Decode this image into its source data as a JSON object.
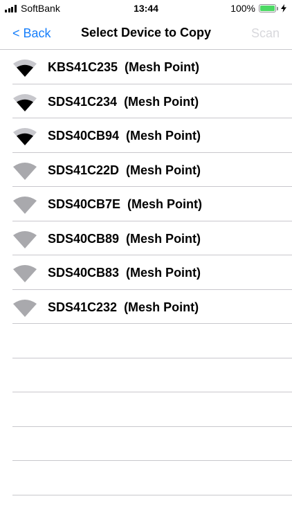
{
  "status_bar": {
    "carrier": "SoftBank",
    "time": "13:44",
    "battery_percent": "100%",
    "battery_color": "#4cd964"
  },
  "nav": {
    "back_label": "< Back",
    "title": "Select Device to Copy",
    "scan_label": "Scan",
    "accent_color": "#157efb"
  },
  "devices": [
    {
      "label": "KBS41C235  (Mesh Point)",
      "signal": "strong",
      "icon": "wifi-strong-icon"
    },
    {
      "label": "SDS41C234  (Mesh Point)",
      "signal": "strong",
      "icon": "wifi-strong-icon"
    },
    {
      "label": "SDS40CB94  (Mesh Point)",
      "signal": "strong",
      "icon": "wifi-strong-icon"
    },
    {
      "label": "SDS41C22D  (Mesh Point)",
      "signal": "weak",
      "icon": "wifi-weak-icon"
    },
    {
      "label": "SDS40CB7E  (Mesh Point)",
      "signal": "weak",
      "icon": "wifi-weak-icon"
    },
    {
      "label": "SDS40CB89  (Mesh Point)",
      "signal": "weak",
      "icon": "wifi-weak-icon"
    },
    {
      "label": "SDS40CB83  (Mesh Point)",
      "signal": "weak",
      "icon": "wifi-weak-icon"
    },
    {
      "label": "SDS41C232  (Mesh Point)",
      "signal": "weak",
      "icon": "wifi-weak-icon"
    }
  ]
}
